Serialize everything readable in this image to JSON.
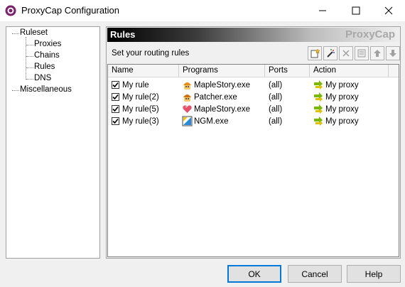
{
  "window": {
    "title": "ProxyCap Configuration"
  },
  "tree": {
    "items": [
      {
        "label": "Ruleset"
      },
      {
        "label": "Proxies"
      },
      {
        "label": "Chains"
      },
      {
        "label": "Rules"
      },
      {
        "label": "DNS"
      },
      {
        "label": "Miscellaneous"
      }
    ]
  },
  "panel": {
    "title": "Rules",
    "brand": "ProxyCap",
    "subtitle": "Set your routing rules",
    "toolbar": [
      "new-rule-icon",
      "wizard-icon",
      "delete-icon",
      "properties-icon",
      "move-up-icon",
      "move-down-icon"
    ]
  },
  "table": {
    "columns": [
      "Name",
      "Programs",
      "Ports",
      "Action"
    ],
    "rows": [
      {
        "name": "My rule",
        "program": "MapleStory.exe",
        "ports": "(all)",
        "action": "My proxy",
        "checked": true,
        "program_icon": "maplestory-icon"
      },
      {
        "name": "My rule(2)",
        "program": "Patcher.exe",
        "ports": "(all)",
        "action": "My proxy",
        "checked": true,
        "program_icon": "patcher-icon"
      },
      {
        "name": "My rule(5)",
        "program": "MapleStory.exe",
        "ports": "(all)",
        "action": "My proxy",
        "checked": true,
        "program_icon": "heart-icon"
      },
      {
        "name": "My rule(3)",
        "program": "NGM.exe",
        "ports": "(all)",
        "action": "My proxy",
        "checked": true,
        "program_icon": "ngm-icon"
      }
    ]
  },
  "buttons": {
    "ok": "OK",
    "cancel": "Cancel",
    "help": "Help"
  }
}
